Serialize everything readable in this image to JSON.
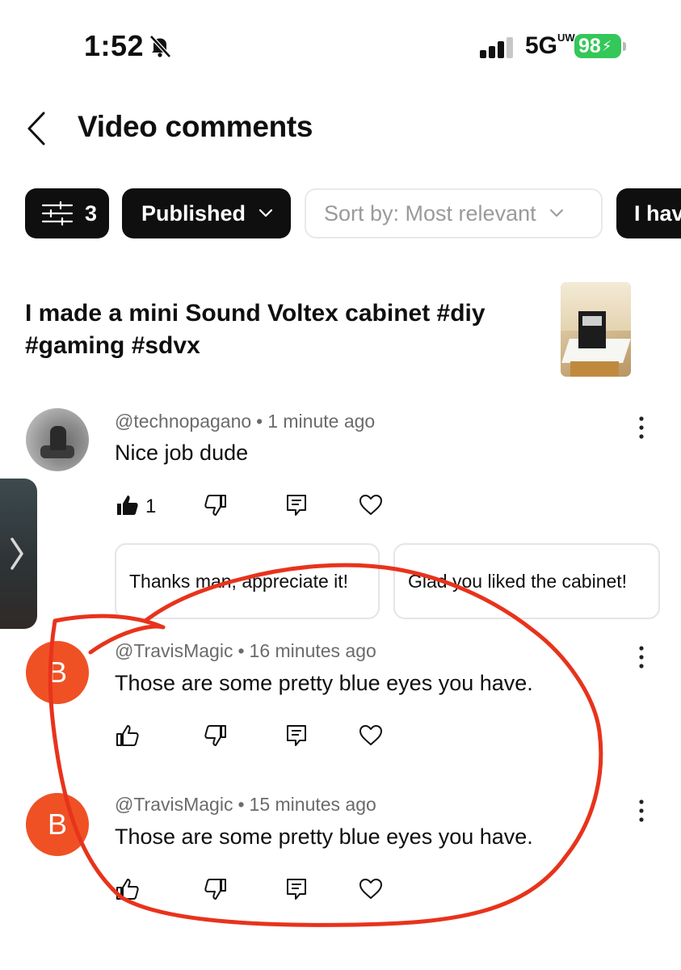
{
  "status_bar": {
    "time": "1:52",
    "network": "5G",
    "network_sup": "UW",
    "battery": "98"
  },
  "header": {
    "title": "Video comments"
  },
  "filters": {
    "filter_count": "3",
    "published_label": "Published",
    "sort_label": "Sort by: Most relevant",
    "extra_label": "I hav"
  },
  "video": {
    "title": "I made a mini Sound Voltex cabinet #diy #gaming #sdvx"
  },
  "comments": [
    {
      "author": "@technopagano",
      "time": "1 minute ago",
      "text": "Nice job dude",
      "likes": "1",
      "avatar_type": "photo"
    },
    {
      "author": "@TravisMagic",
      "time": "16 minutes ago",
      "text": "Those are some pretty blue eyes you have.",
      "avatar_letter": "B"
    },
    {
      "author": "@TravisMagic",
      "time": "15 minutes ago",
      "text": "Those are some pretty blue eyes you have.",
      "avatar_letter": "B"
    }
  ],
  "suggested_replies": [
    "Thanks man, appreciate it!",
    "Glad you liked the cabinet!"
  ],
  "colors": {
    "avatar_letter_bg": "#ef5125",
    "annotation": "#e8331c",
    "battery": "#34c759",
    "chip_dark": "#0f0f0f"
  },
  "icons": {
    "bell": "bell-slash-icon",
    "signal": "signal-bars-icon",
    "back": "chevron-left-icon",
    "filter": "sliders-icon",
    "like": "thumbs-up-icon",
    "dislike": "thumbs-down-icon",
    "reply": "reply-icon",
    "heart": "heart-icon",
    "more": "kebab-icon"
  }
}
